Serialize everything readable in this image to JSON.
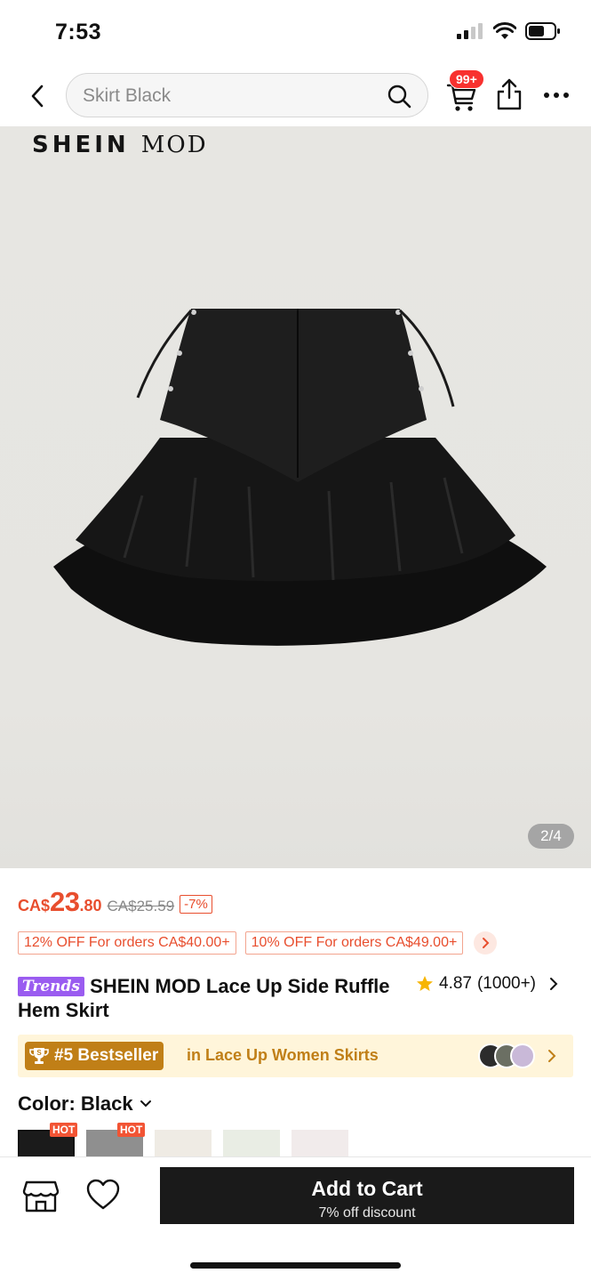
{
  "status_bar": {
    "time": "7:53"
  },
  "nav": {
    "search_placeholder": "Skirt Black",
    "cart_badge": "99+",
    "icons": [
      "back-chevron-icon",
      "search-icon",
      "cart-icon",
      "share-icon",
      "more-dots-icon"
    ]
  },
  "gallery": {
    "brand_bold": "SHEIN",
    "brand_thin": "MOD",
    "page_indicator": "2/4"
  },
  "price": {
    "currency": "CA$",
    "main": "23",
    "cents": ".80",
    "original": "CA$25.59",
    "discount": "-7%",
    "accent_color": "#e84e2e"
  },
  "coupons": [
    {
      "label": "12% OFF For orders CA$40.00+"
    },
    {
      "label": "10% OFF For orders CA$49.00+"
    }
  ],
  "product": {
    "trends_badge": "Trends",
    "title": "SHEIN MOD Lace Up Side Ruffle Hem Skirt",
    "rating": "4.87",
    "review_count": "(1000+)"
  },
  "bestseller": {
    "rank": "#5 Bestseller",
    "category": "in Lace Up Women Skirts"
  },
  "color": {
    "label": "Color: Black",
    "swatches": [
      {
        "name": "Black",
        "hot": true,
        "hot_label": "HOT",
        "selected": true
      },
      {
        "name": "White",
        "hot": true,
        "hot_label": "HOT",
        "selected": false
      },
      {
        "name": "Apricot",
        "hot": false,
        "selected": false
      },
      {
        "name": "Army Green",
        "hot": false,
        "selected": false
      },
      {
        "name": "Pink",
        "hot": false,
        "selected": false
      }
    ]
  },
  "bottom_bar": {
    "add_to_cart": "Add to Cart",
    "add_to_cart_sub": "7% off discount",
    "icons": [
      "store-icon",
      "heart-icon"
    ]
  }
}
